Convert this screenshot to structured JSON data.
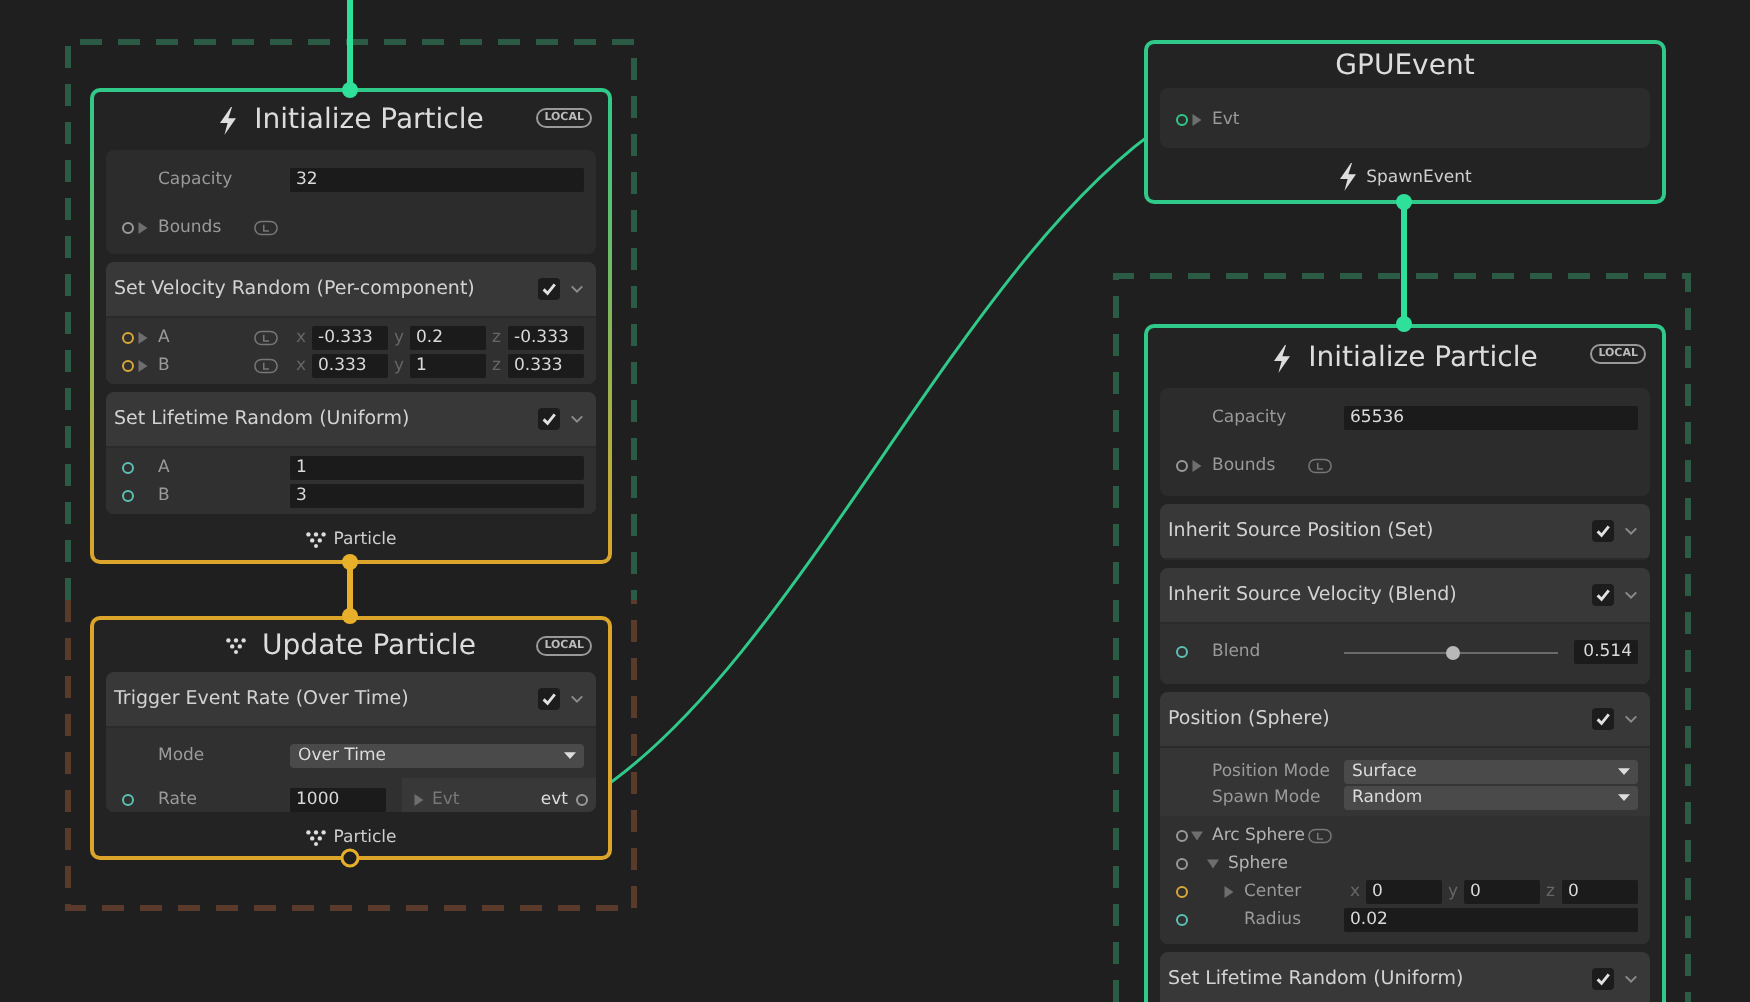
{
  "nodes": [
    {
      "kind": "initialize",
      "title": "Initialize Particle",
      "space": "LOCAL",
      "settings": [
        {
          "kind": "field",
          "label": "Capacity",
          "value": "32"
        },
        {
          "kind": "expand",
          "label": "Bounds",
          "color": "#9a9a9a",
          "expanded": false,
          "lock": true
        }
      ],
      "blocks": [
        {
          "title": "Set Velocity Random (Per-component)",
          "enabled": true,
          "rows": [
            {
              "kind": "vector",
              "label": "A",
              "color": "#d9a838",
              "expanded": false,
              "lock": true,
              "components": [
                {
                  "axis": "x",
                  "value": "-0.333"
                },
                {
                  "axis": "y",
                  "value": "0.2"
                },
                {
                  "axis": "z",
                  "value": "-0.333"
                }
              ]
            },
            {
              "kind": "vector",
              "label": "B",
              "color": "#d9a838",
              "expanded": false,
              "lock": true,
              "components": [
                {
                  "axis": "x",
                  "value": "0.333"
                },
                {
                  "axis": "y",
                  "value": "1"
                },
                {
                  "axis": "z",
                  "value": "0.333"
                }
              ]
            }
          ]
        },
        {
          "title": "Set Lifetime Random (Uniform)",
          "enabled": true,
          "rows": [
            {
              "kind": "field",
              "label": "A",
              "color": "#5cc0b5",
              "value": "1"
            },
            {
              "kind": "field",
              "label": "B",
              "color": "#5cc0b5",
              "value": "3"
            }
          ]
        }
      ],
      "footer": {
        "label": "Particle"
      }
    },
    {
      "kind": "update",
      "title": "Update Particle",
      "space": "LOCAL",
      "blocks": [
        {
          "title": "Trigger Event Rate (Over Time)",
          "enabled": true,
          "rows": [
            {
              "kind": "dropdown",
              "label": "Mode",
              "value": "Over Time"
            },
            {
              "kind": "event",
              "label": "Rate",
              "color": "#5cc0b5",
              "value": "1000",
              "output": "Evt",
              "output_port": "evt"
            }
          ]
        }
      ],
      "footer": {
        "label": "Particle"
      }
    },
    {
      "kind": "event",
      "title": "GPUEvent",
      "settings": [
        {
          "kind": "expand",
          "label": "Evt",
          "color": "#2fc98a",
          "expanded": false
        }
      ],
      "footer": {
        "label": "SpawnEvent"
      }
    },
    {
      "kind": "initialize",
      "title": "Initialize Particle",
      "space": "LOCAL",
      "settings": [
        {
          "kind": "field",
          "label": "Capacity",
          "value": "65536"
        },
        {
          "kind": "expand",
          "label": "Bounds",
          "color": "#9a9a9a",
          "expanded": false,
          "lock": true
        }
      ],
      "blocks": [
        {
          "title": "Inherit Source Position (Set)",
          "enabled": true
        },
        {
          "title": "Inherit Source Velocity (Blend)",
          "enabled": true,
          "rows": [
            {
              "kind": "slider",
              "label": "Blend",
              "color": "#5cc0b5",
              "level": 0.514,
              "value": "0.514"
            }
          ]
        },
        {
          "title": "Position (Sphere)",
          "enabled": true,
          "options": [
            {
              "kind": "dropdown",
              "label": "Position Mode",
              "value": "Surface"
            },
            {
              "kind": "dropdown",
              "label": "Spawn Mode",
              "value": "Random"
            }
          ],
          "rows": [
            {
              "kind": "group",
              "label": "Arc Sphere",
              "color": "#9a9a9a",
              "expanded": true,
              "lock": true,
              "children": [
                {
                  "kind": "group",
                  "label": "Sphere",
                  "color": "#9a9a9a",
                  "expanded": true,
                  "children": [
                    {
                      "kind": "vector",
                      "label": "Center",
                      "color": "#d9a838",
                      "expanded": false,
                      "components": [
                        {
                          "axis": "x",
                          "value": "0"
                        },
                        {
                          "axis": "y",
                          "value": "0"
                        },
                        {
                          "axis": "z",
                          "value": "0"
                        }
                      ]
                    },
                    {
                      "kind": "field",
                      "label": "Radius",
                      "color": "#5cc0b5",
                      "value": "0.02"
                    }
                  ]
                }
              ]
            }
          ]
        },
        {
          "title": "Set Lifetime Random (Uniform)",
          "enabled": true
        }
      ]
    }
  ]
}
